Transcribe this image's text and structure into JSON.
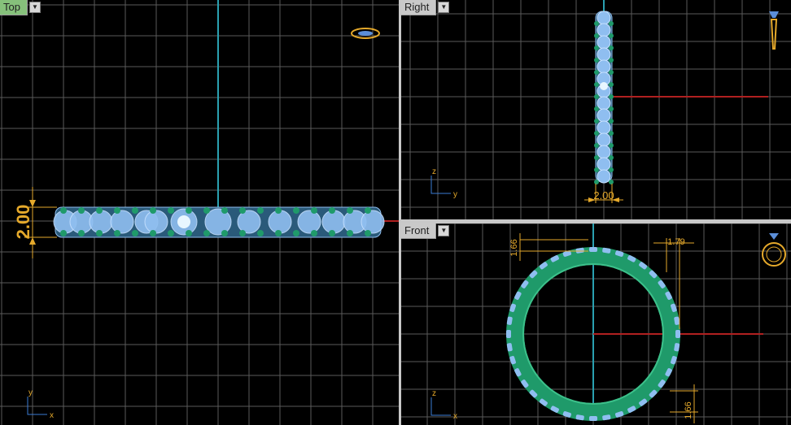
{
  "viewports": {
    "top": {
      "label": "Top",
      "dimension": "2.00",
      "axis_x": "x",
      "axis_y": "y"
    },
    "right": {
      "label": "Right",
      "dimension": "2.00",
      "axis_z": "z",
      "axis_y": "y"
    },
    "front": {
      "label": "Front",
      "dim_a": "1.66",
      "dim_b": "1.79",
      "dim_c": "1.66",
      "axis_z": "z",
      "axis_x": "x"
    }
  },
  "icons": {
    "top_preview": "ring-preview-icon",
    "right_preview": "ring-side-icon",
    "front_preview": "ring-front-icon",
    "dropdown": "chevron-down-icon"
  },
  "colors": {
    "background": "#000000",
    "grid": "#5a5a5a",
    "axis_cyan": "#2aa0b0",
    "axis_red": "#b02020",
    "gem": "#8fbef0",
    "metal": "#1f9a6a",
    "dimension": "#e5a92b",
    "active_tab": "#86c17b"
  }
}
